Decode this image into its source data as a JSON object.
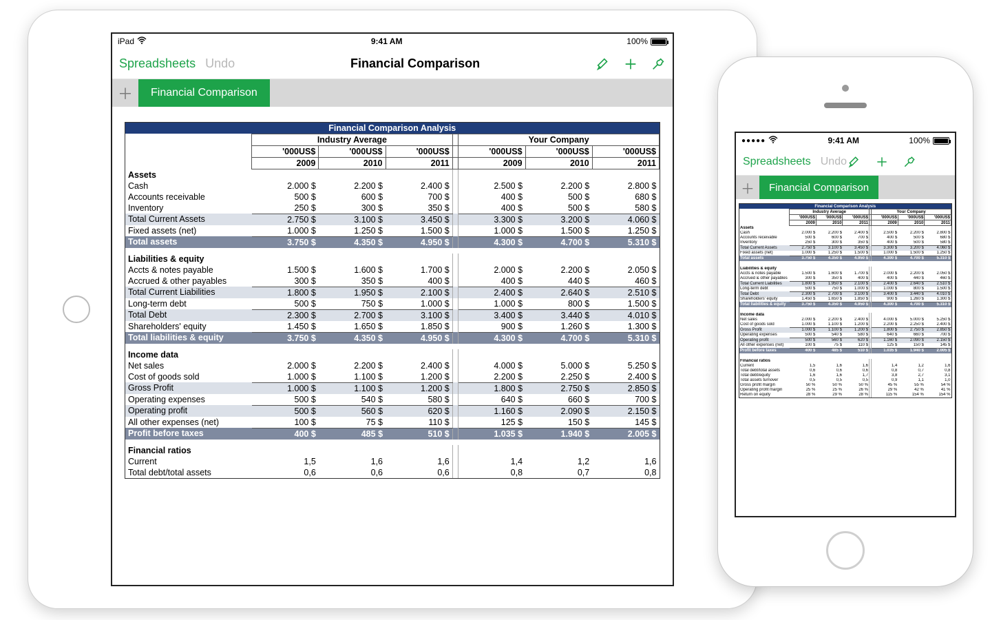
{
  "status": {
    "ipad_carrier": "iPad",
    "iphone_dots": "●●●●●",
    "time": "9:41 AM",
    "battery": "100%"
  },
  "toolbar": {
    "spreadsheets": "Spreadsheets",
    "undo": "Undo",
    "doc_title": "Financial Comparison"
  },
  "tab": {
    "name": "Financial Comparison"
  },
  "sheet": {
    "title": "Financial Comparison Analysis",
    "group_a": "Industry Average",
    "group_b": "Your Company",
    "unit_label": "'000US$",
    "years": [
      "2009",
      "2010",
      "2011"
    ],
    "sections": {
      "assets": {
        "title": "Assets",
        "rows": [
          {
            "label": "Cash",
            "a": [
              "2.000 $",
              "2.200 $",
              "2.400 $"
            ],
            "b": [
              "2.500 $",
              "2.200 $",
              "2.800 $"
            ],
            "style": "plain underline-last"
          },
          {
            "label": "Accounts receivable",
            "a": [
              "500 $",
              "600 $",
              "700 $"
            ],
            "b": [
              "400 $",
              "500 $",
              "680 $"
            ],
            "style": "plain"
          },
          {
            "label": "Inventory",
            "a": [
              "250 $",
              "300 $",
              "350 $"
            ],
            "b": [
              "400 $",
              "500 $",
              "580 $"
            ],
            "style": "plain box-bottom"
          },
          {
            "label": "Total Current Assets",
            "a": [
              "2.750 $",
              "3.100 $",
              "3.450 $"
            ],
            "b": [
              "3.300 $",
              "3.200 $",
              "4.060 $"
            ],
            "style": "total"
          },
          {
            "label": "Fixed assets (net)",
            "a": [
              "1.000 $",
              "1.250 $",
              "1.500 $"
            ],
            "b": [
              "1.000 $",
              "1.500 $",
              "1.250 $"
            ],
            "style": "plain box-bottom"
          },
          {
            "label": "Total assets",
            "a": [
              "3.750 $",
              "4.350 $",
              "4.950 $"
            ],
            "b": [
              "4.300 $",
              "4.700 $",
              "5.310 $"
            ],
            "style": "grand"
          }
        ]
      },
      "liab": {
        "title": "Liabilities & equity",
        "rows": [
          {
            "label": "Accts & notes payable",
            "a": [
              "1.500 $",
              "1.600 $",
              "1.700 $"
            ],
            "b": [
              "2.000 $",
              "2.200 $",
              "2.050 $"
            ],
            "style": "plain"
          },
          {
            "label": "Accrued & other payables",
            "a": [
              "300 $",
              "350 $",
              "400 $"
            ],
            "b": [
              "400 $",
              "440 $",
              "460 $"
            ],
            "style": "plain box-bottom"
          },
          {
            "label": "Total Current Liabilities",
            "a": [
              "1.800 $",
              "1.950 $",
              "2.100 $"
            ],
            "b": [
              "2.400 $",
              "2.640 $",
              "2.510 $"
            ],
            "style": "total"
          },
          {
            "label": "Long-term debt",
            "a": [
              "500 $",
              "750 $",
              "1.000 $"
            ],
            "b": [
              "1.000 $",
              "800 $",
              "1.500 $"
            ],
            "style": "plain box-bottom"
          },
          {
            "label": "Total Debt",
            "a": [
              "2.300 $",
              "2.700 $",
              "3.100 $"
            ],
            "b": [
              "3.400 $",
              "3.440 $",
              "4.010 $"
            ],
            "style": "total"
          },
          {
            "label": "Shareholders' equity",
            "a": [
              "1.450 $",
              "1.650 $",
              "1.850 $"
            ],
            "b": [
              "900 $",
              "1.260 $",
              "1.300 $"
            ],
            "style": "plain box-bottom"
          },
          {
            "label": "Total liabilities & equity",
            "a": [
              "3.750 $",
              "4.350 $",
              "4.950 $"
            ],
            "b": [
              "4.300 $",
              "4.700 $",
              "5.310 $"
            ],
            "style": "grand"
          }
        ]
      },
      "income": {
        "title": "Income data",
        "rows": [
          {
            "label": "Net sales",
            "a": [
              "2.000 $",
              "2.200 $",
              "2.400 $"
            ],
            "b": [
              "4.000 $",
              "5.000 $",
              "5.250 $"
            ],
            "style": "plain"
          },
          {
            "label": "Cost of goods sold",
            "a": [
              "1.000 $",
              "1.100 $",
              "1.200 $"
            ],
            "b": [
              "2.200 $",
              "2.250 $",
              "2.400 $"
            ],
            "style": "plain box-bottom"
          },
          {
            "label": "Gross Profit",
            "a": [
              "1.000 $",
              "1.100 $",
              "1.200 $"
            ],
            "b": [
              "1.800 $",
              "2.750 $",
              "2.850 $"
            ],
            "style": "total"
          },
          {
            "label": "Operating expenses",
            "a": [
              "500 $",
              "540 $",
              "580 $"
            ],
            "b": [
              "640 $",
              "660 $",
              "700 $"
            ],
            "style": "plain box-bottom"
          },
          {
            "label": "Operating profit",
            "a": [
              "500 $",
              "560 $",
              "620 $"
            ],
            "b": [
              "1.160 $",
              "2.090 $",
              "2.150 $"
            ],
            "style": "total"
          },
          {
            "label": "All other expenses (net)",
            "a": [
              "100 $",
              "75 $",
              "110 $"
            ],
            "b": [
              "125 $",
              "150 $",
              "145 $"
            ],
            "style": "plain box-bottom"
          },
          {
            "label": "Profit before taxes",
            "a": [
              "400 $",
              "485 $",
              "510 $"
            ],
            "b": [
              "1.035 $",
              "1.940 $",
              "2.005 $"
            ],
            "style": "grand"
          }
        ]
      },
      "ratios": {
        "title": "Financial ratios",
        "rows": [
          {
            "label": "Current",
            "a": [
              "1,5",
              "1,6",
              "1,6"
            ],
            "b": [
              "1,4",
              "1,2",
              "1,6"
            ],
            "style": "plain"
          },
          {
            "label": "Total debt/total assets",
            "a": [
              "0,6",
              "0,6",
              "0,6"
            ],
            "b": [
              "0,8",
              "0,7",
              "0,8"
            ],
            "style": "plain"
          }
        ]
      },
      "ratios_extra": {
        "rows": [
          {
            "label": "Total debt/equity",
            "a": [
              "1,6",
              "1,6",
              "1,7"
            ],
            "b": [
              "3,8",
              "2,7",
              "3,1"
            ],
            "style": "plain"
          },
          {
            "label": "Total assets turnover",
            "a": [
              "0,5",
              "0,5",
              "0,5"
            ],
            "b": [
              "0,9",
              "1,1",
              "1,0"
            ],
            "style": "plain"
          },
          {
            "label": "Gross profit margin",
            "a": [
              "50 %",
              "50 %",
              "50 %"
            ],
            "b": [
              "45 %",
              "55 %",
              "54 %"
            ],
            "style": "plain"
          },
          {
            "label": "Operating profit margin",
            "a": [
              "25 %",
              "25 %",
              "26 %"
            ],
            "b": [
              "29 %",
              "42 %",
              "41 %"
            ],
            "style": "plain"
          },
          {
            "label": "Return on equity",
            "a": [
              "28 %",
              "29 %",
              "28 %"
            ],
            "b": [
              "115 %",
              "154 %",
              "154 %"
            ],
            "style": "plain"
          }
        ]
      }
    }
  }
}
